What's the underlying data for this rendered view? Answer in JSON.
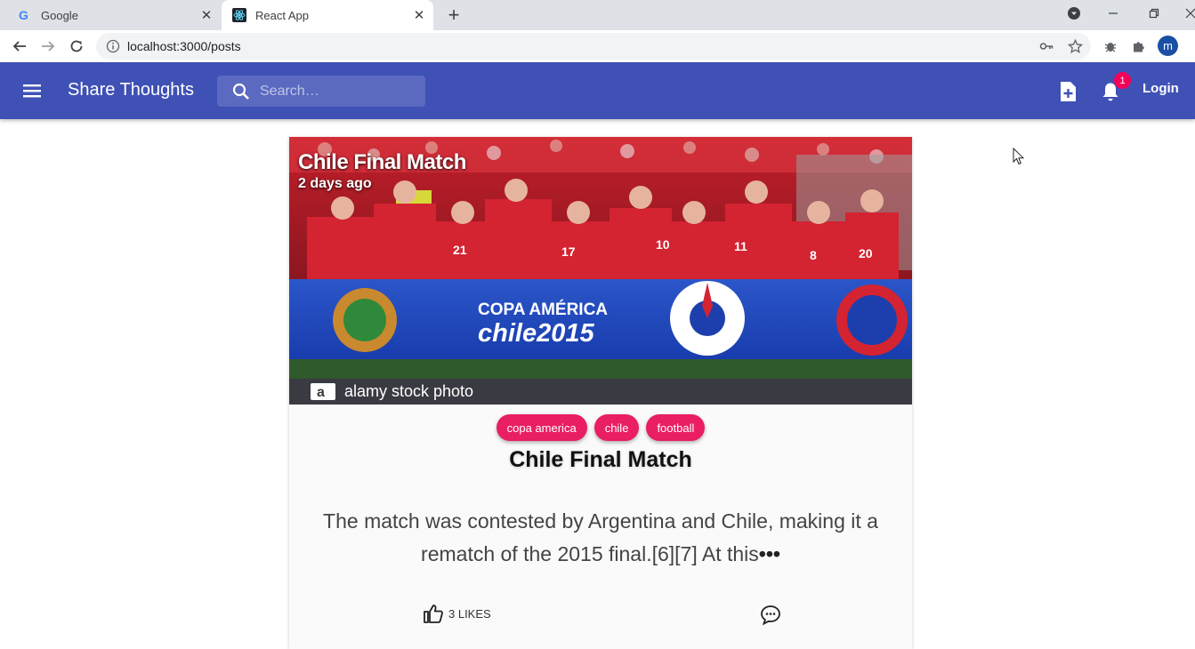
{
  "browser": {
    "tabs": [
      {
        "title": "Google",
        "icon": "google-icon",
        "active": false
      },
      {
        "title": "React App",
        "icon": "react-icon",
        "active": true
      }
    ],
    "url": "localhost:3000/posts",
    "profile_initial": "m"
  },
  "appbar": {
    "brand": "Share Thoughts",
    "search_placeholder": "Search…",
    "notification_count": "1",
    "login_label": "Login",
    "color": "#3f51b5"
  },
  "post": {
    "overlay_title": "Chile Final Match",
    "overlay_time": "2 days ago",
    "tags": [
      "copa america",
      "chile",
      "football"
    ],
    "title": "Chile Final Match",
    "body": "The match was contested by Argentina and Chile, making it a rematch of the 2015 final.[6][7] At this",
    "more": "•••",
    "likes_label": "3 LIKES",
    "image": {
      "banner_line1": "COPA AMÉRICA",
      "banner_line2": "chile2015",
      "watermark": "alamy stock photo",
      "watermark_letter": "a"
    },
    "tag_color": "#e91e63"
  }
}
